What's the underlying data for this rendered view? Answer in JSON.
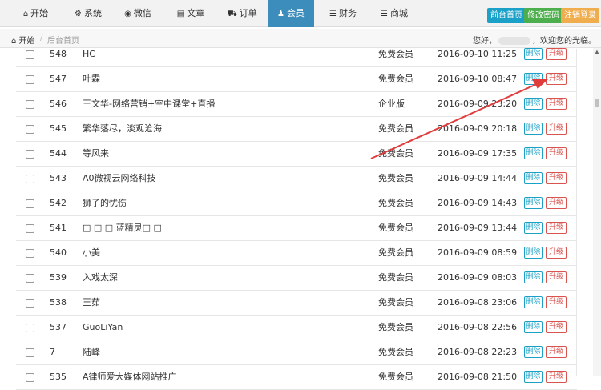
{
  "nav": {
    "tabs": [
      {
        "label": "开始",
        "icon": "home-icon",
        "glyph": "⌂"
      },
      {
        "label": "系统",
        "icon": "gear-icon",
        "glyph": "⚙"
      },
      {
        "label": "微信",
        "icon": "wechat-icon",
        "glyph": "◉"
      },
      {
        "label": "文章",
        "icon": "document-icon",
        "glyph": "▤"
      },
      {
        "label": "订单",
        "icon": "cart-icon",
        "glyph": "⛟"
      },
      {
        "label": "会员",
        "icon": "user-icon",
        "glyph": "♟"
      },
      {
        "label": "财务",
        "icon": "list-icon",
        "glyph": "☰"
      },
      {
        "label": "商城",
        "icon": "list-icon",
        "glyph": "☰"
      }
    ],
    "active_tab": "会员",
    "right_buttons": [
      "前台首页",
      "修改密码",
      "注销登录"
    ]
  },
  "breadcrumb": {
    "home": "开始",
    "current": "后台首页"
  },
  "welcome": {
    "prefix": "您好，",
    "suffix": "，欢迎您的光临。"
  },
  "table": {
    "delete_label": "删除",
    "upgrade_label": "升级",
    "rows": [
      {
        "id": "548",
        "name": "HC",
        "level": "免费会员",
        "date": "2016-09-10 11:25"
      },
      {
        "id": "547",
        "name": "叶霖",
        "level": "免费会员",
        "date": "2016-09-10 08:47"
      },
      {
        "id": "546",
        "name": "王文华-网络营销+空中课堂+直播",
        "level": "企业版",
        "date": "2016-09-09 23:20"
      },
      {
        "id": "545",
        "name": "繁华落尽，淡观沧海",
        "level": "免费会员",
        "date": "2016-09-09 20:18"
      },
      {
        "id": "544",
        "name": "等风来",
        "level": "免费会员",
        "date": "2016-09-09 17:35"
      },
      {
        "id": "543",
        "name": "A0微视云网络科技",
        "level": "免费会员",
        "date": "2016-09-09 14:44"
      },
      {
        "id": "542",
        "name": "狮子的忧伤",
        "level": "免费会员",
        "date": "2016-09-09 14:43"
      },
      {
        "id": "541",
        "name": "□ □ □ 蓝精灵□ □",
        "level": "免费会员",
        "date": "2016-09-09 13:44"
      },
      {
        "id": "540",
        "name": "小美",
        "level": "免费会员",
        "date": "2016-09-09 08:59"
      },
      {
        "id": "539",
        "name": "入戏太深",
        "level": "免费会员",
        "date": "2016-09-09 08:03"
      },
      {
        "id": "538",
        "name": "王茹",
        "level": "免费会员",
        "date": "2016-09-08 23:06"
      },
      {
        "id": "537",
        "name": "GuoLiYan",
        "level": "免费会员",
        "date": "2016-09-08 22:56"
      },
      {
        "id": "7",
        "name": "陆峰",
        "level": "免费会员",
        "date": "2016-09-08 22:23"
      },
      {
        "id": "535",
        "name": "A律师爱大媒体网站推广",
        "level": "免费会员",
        "date": "2016-09-08 21:50"
      }
    ]
  },
  "colors": {
    "active_tab": "#3c8dbc",
    "delete": "#1ba1c8",
    "upgrade": "#d9534f",
    "annotation_arrow": "#e03c3c"
  }
}
